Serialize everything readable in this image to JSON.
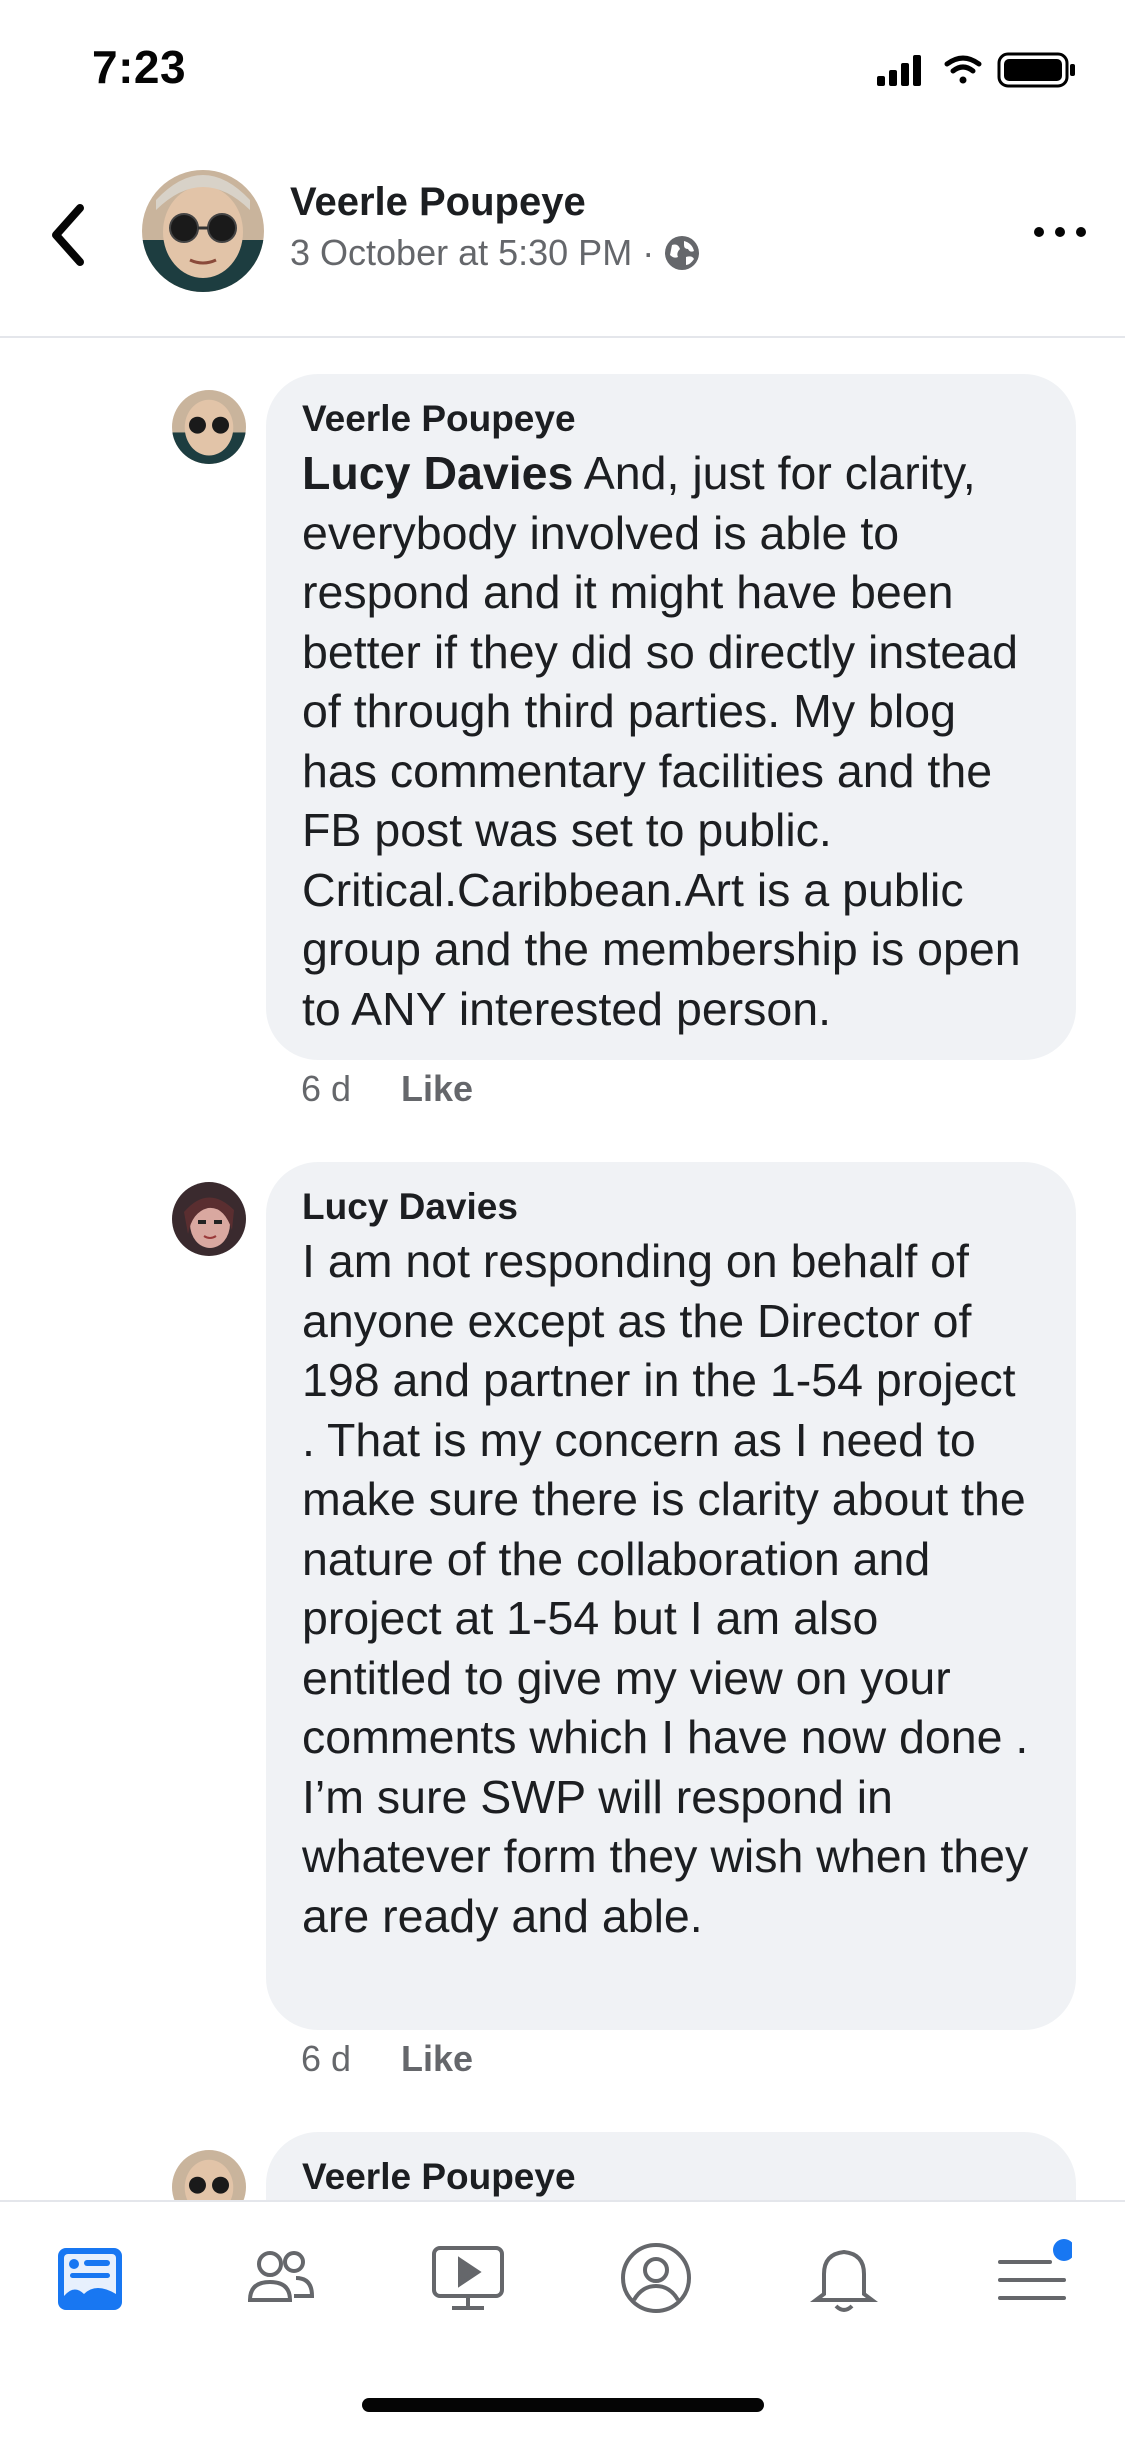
{
  "status_bar": {
    "time": "7:23"
  },
  "header": {
    "author": "Veerle Poupeye",
    "timestamp": "3 October at 5:30 PM",
    "separator": "·",
    "privacy_icon": "globe-icon"
  },
  "comments": [
    {
      "author": "Veerle Poupeye",
      "mention": "Lucy Davies",
      "text": " And, just for clarity, everybody involved is able to respond and it might have been better if they did so directly instead of through third parties. My blog has commentary facilities and the FB post was set to public. Critical.Caribbean.Art is a public group and the membership is open to ANY interested person.",
      "age": "6 d",
      "like_label": "Like"
    },
    {
      "author": "Lucy Davies",
      "text": "I am not responding on behalf of anyone except as the Director of 198 and partner in the 1-54 project . That is my concern as I need to make sure there is clarity about the nature of the collaboration and project at 1-54 but I am also entitled to give my view on your comments which I have now done . I’m sure SWP will respond in whatever form they wish when they are ready and able.",
      "age": "6 d",
      "like_label": "Like"
    },
    {
      "author": "Veerle Poupeye"
    }
  ],
  "bottom_nav": {
    "items": [
      "news-feed-icon",
      "friends-icon",
      "watch-icon",
      "profile-icon",
      "notifications-icon",
      "menu-icon"
    ],
    "active": "news-feed-icon",
    "accent_color": "#1877f2"
  }
}
